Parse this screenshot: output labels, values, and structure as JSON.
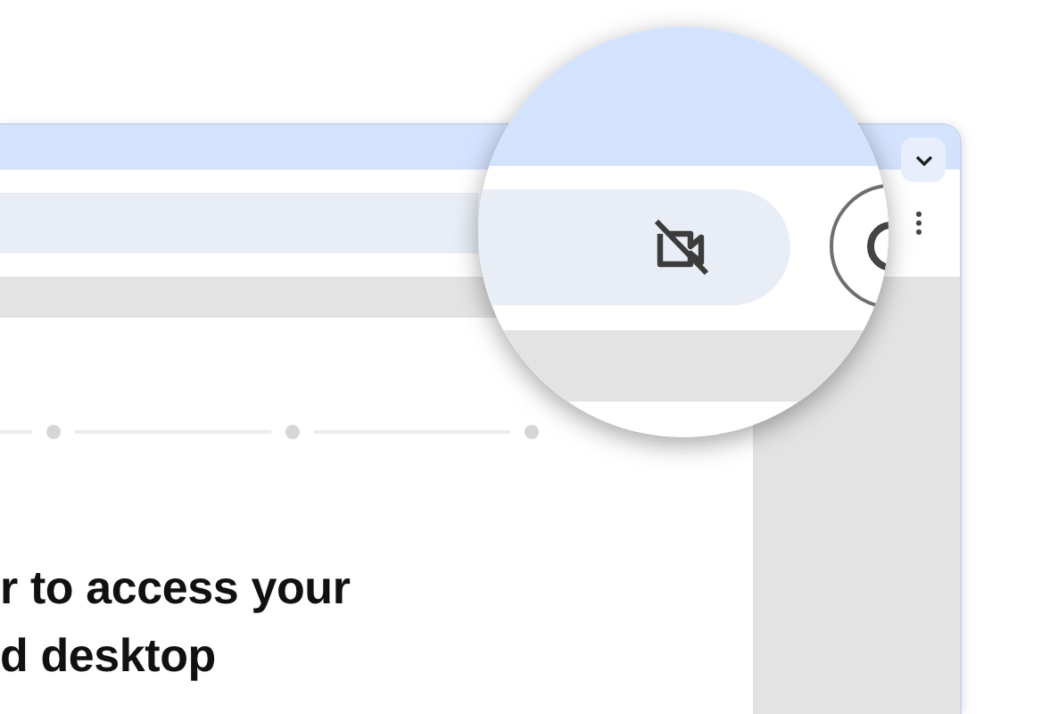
{
  "page": {
    "heading_lines": [
      "r to access your",
      "d desktop"
    ]
  }
}
